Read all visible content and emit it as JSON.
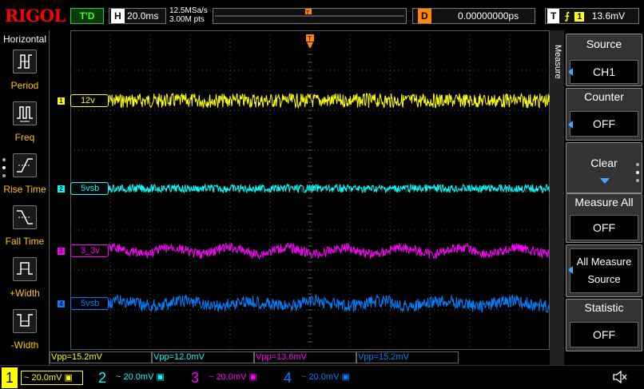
{
  "brand": "RIGOL",
  "status": "T'D",
  "horizontal": {
    "letter": "H",
    "timebase": "20.0ms",
    "sample_rate": "12.5MSa/s",
    "points": "3.00M pts"
  },
  "delay": {
    "letter": "D",
    "value": "0.00000000ps"
  },
  "trigger": {
    "letter": "T",
    "source": "1",
    "level": "13.6mV"
  },
  "left_menu": {
    "title": "Horizontal",
    "items": [
      {
        "label": "Period",
        "icon": "period-icon"
      },
      {
        "label": "Freq",
        "icon": "frequency-icon"
      },
      {
        "label": "Rise Time",
        "icon": "rise-time-icon"
      },
      {
        "label": "Fall Time",
        "icon": "fall-time-icon"
      },
      {
        "label": "+Width",
        "icon": "positive-width-icon"
      },
      {
        "label": "-Width",
        "icon": "negative-width-icon"
      }
    ]
  },
  "right_menu": {
    "title": "Measure",
    "source": {
      "label": "Source",
      "value": "CH1"
    },
    "counter": {
      "label": "Counter",
      "value": "OFF"
    },
    "clear": {
      "label": "Clear"
    },
    "measure_all": {
      "label": "Measure All",
      "value": "OFF"
    },
    "all_measure_source": {
      "label1": "All Measure",
      "label2": "Source"
    },
    "statistic": {
      "label": "Statistic",
      "value": "OFF"
    }
  },
  "channels": [
    {
      "num": "1",
      "label": "12v",
      "color": "#ffff00",
      "scale": "20.0mV",
      "measurement": "Vpp=15.2mV"
    },
    {
      "num": "2",
      "label": "5vsb",
      "color": "#00ffff",
      "scale": "20.0mV",
      "measurement": "Vpp=12.0mV"
    },
    {
      "num": "3",
      "label": "3_3v",
      "color": "#ff00ff",
      "scale": "20.0mV",
      "measurement": "Vpp=13.6mV"
    },
    {
      "num": "4",
      "label": "5vsb",
      "color": "#0080ff",
      "scale": "20.0mV",
      "measurement": "Vpp=15.2mV"
    }
  ],
  "colors": {
    "grid": "#555555",
    "accent": "#ff8800",
    "menu_label": "#ffc400"
  }
}
